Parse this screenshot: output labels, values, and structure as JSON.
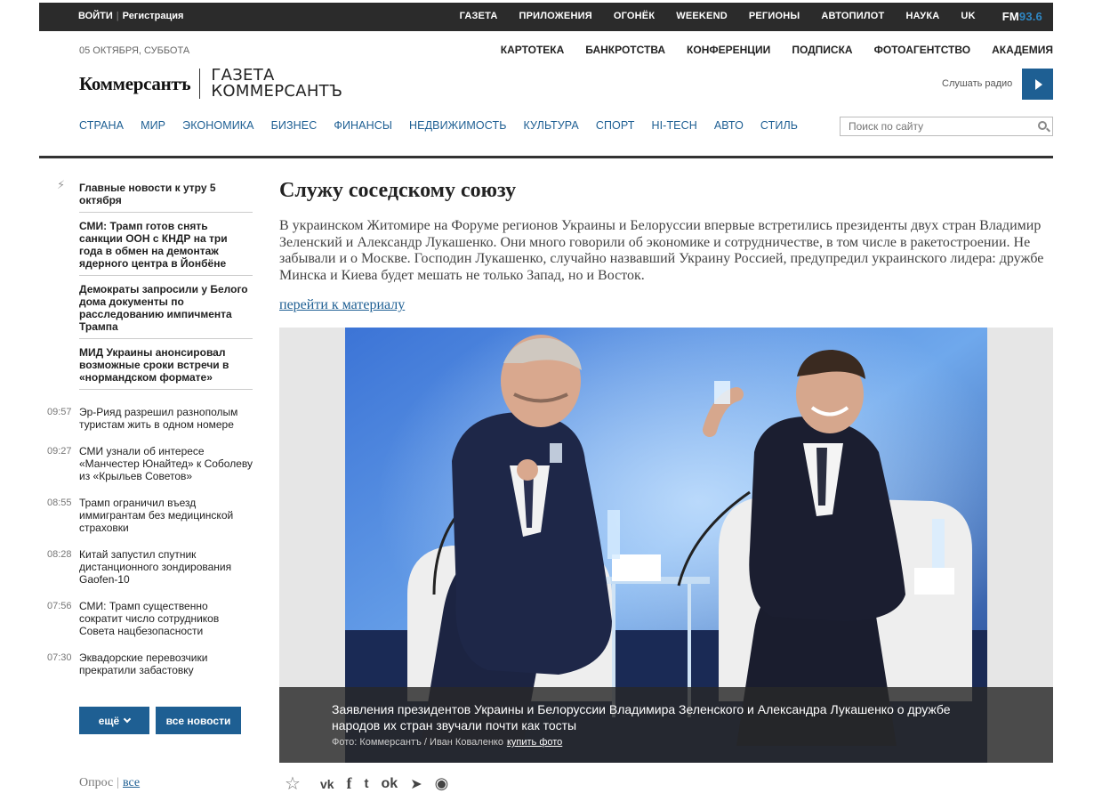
{
  "topbar": {
    "login": "ВОЙТИ",
    "register": "Регистрация",
    "nav": [
      "ГАЗЕТА",
      "ПРИЛОЖЕНИЯ",
      "ОГОНЁК",
      "WEEKEND",
      "РЕГИОНЫ",
      "АВТОПИЛОТ",
      "НАУКА",
      "UK"
    ],
    "fm_a": "FM",
    "fm_b": "93.6"
  },
  "header": {
    "date": "05 ОКТЯБРЯ, СУББОТА",
    "sections": [
      "КАРТОТЕКА",
      "БАНКРОТСТВА",
      "КОНФЕРЕНЦИИ",
      "ПОДПИСКА",
      "ФОТОАГЕНТСТВО",
      "АКАДЕМИЯ"
    ],
    "brand": "Коммерсантъ",
    "paper_line1": "ГАЗЕТА",
    "paper_line2": "КОММЕРСАНТЪ",
    "radio_label": "Слушать радио"
  },
  "mainnav": [
    "СТРАНА",
    "МИР",
    "ЭКОНОМИКА",
    "БИЗНЕС",
    "ФИНАНСЫ",
    "НЕДВИЖИМОСТЬ",
    "КУЛЬТУРА",
    "СПОРТ",
    "HI-TECH",
    "АВТО",
    "СТИЛЬ"
  ],
  "search": {
    "placeholder": "Поиск по сайту"
  },
  "sidebar": {
    "lead_items": [
      "Главные новости к утру 5 октября",
      "СМИ: Трамп готов снять санкции ООН с КНДР на три года в обмен на демонтаж ядерного центра в Йонбёне",
      "Демократы запросили у Белого дома документы по расследованию импичмента Трампа",
      "МИД Украины анонсировал возможные сроки встречи в «нормандском формате»"
    ],
    "timed_items": [
      {
        "time": "09:57",
        "text": "Эр-Рияд разрешил разнополым туристам жить в одном номере"
      },
      {
        "time": "09:27",
        "text": "СМИ узнали об интересе «Манчестер Юнайтед» к Соболеву из «Крыльев Советов»"
      },
      {
        "time": "08:55",
        "text": "Трамп ограничил въезд иммигрантам без медицинской страховки"
      },
      {
        "time": "08:28",
        "text": "Китай запустил спутник дистанционного зондирования Gaofen-10"
      },
      {
        "time": "07:56",
        "text": "СМИ: Трамп существенно сократит число сотрудников Совета нацбезопасности"
      },
      {
        "time": "07:30",
        "text": "Эквадорские перевозчики прекратили забастовку"
      }
    ],
    "more_label": "ещё",
    "all_news_label": "все новости",
    "poll_label": "Опрос",
    "poll_all": "все"
  },
  "article": {
    "title": "Служу соседскому союзу",
    "lead": "В украинском Житомире на Форуме регионов Украины и Белоруссии впервые встретились президенты двух стран Владимир Зеленский и Александр Лукашенко. Они много говорили об экономике и сотрудничестве, в том числе в ракетостроении. Не забывали и о Москве. Господин Лукашенко, случайно назвавший Украину Россией, предупредил украинского лидера: дружбе Минска и Киева будет мешать не только Запад, но и Восток.",
    "more_link": "перейти к материалу",
    "caption": "Заявления президентов Украины и Белоруссии Владимира Зеленского и Александра Лукашенко о дружбе народов их стран звучали почти как тосты",
    "credit": "Фото: Коммерсантъ / Иван Коваленко",
    "buy_photo": "купить фото"
  },
  "share": {
    "icons": [
      "favorite-add-icon",
      "vk-icon",
      "facebook-icon",
      "twitter-icon",
      "odnoklassniki-icon",
      "telegram-icon",
      "whatsapp-icon"
    ]
  },
  "colors": {
    "accent": "#1e5f93",
    "topbar": "#2b2b2b"
  }
}
